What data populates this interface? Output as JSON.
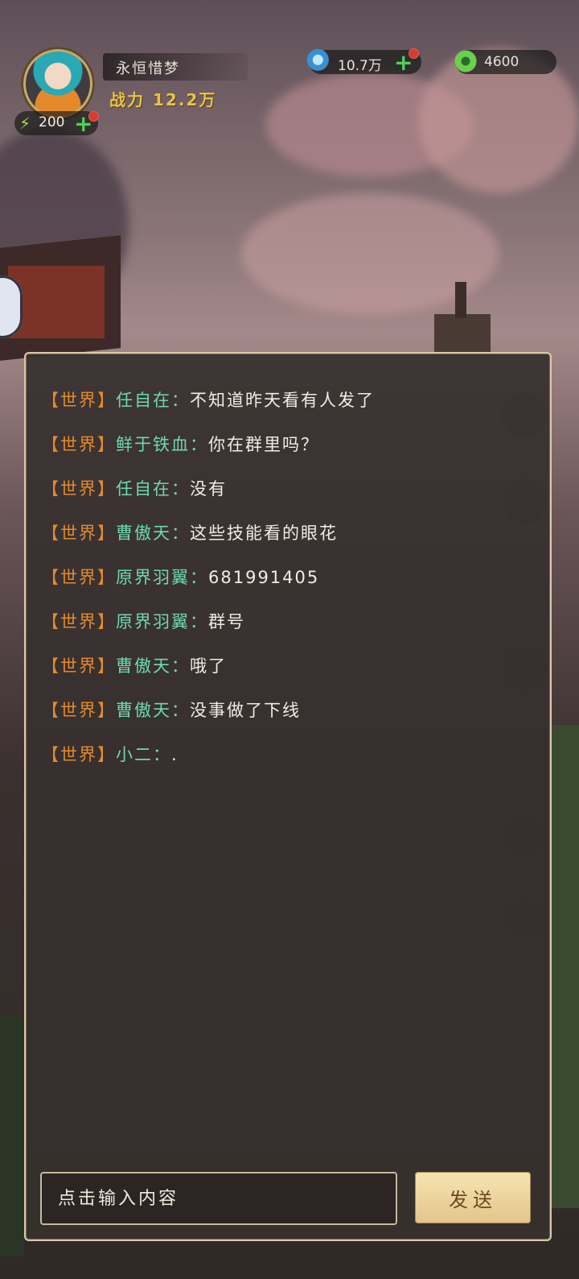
{
  "player": {
    "name": "永恒惜梦",
    "power_label": "战力",
    "power_value": "12.2万",
    "energy": "200"
  },
  "resources": [
    {
      "icon": "jade-gem-icon",
      "value": "10.7万"
    },
    {
      "icon": "green-coin-icon",
      "value": "4600"
    }
  ],
  "chat": {
    "messages": [
      {
        "channel": "【世界】",
        "sender": "任自在：",
        "text": "不知道昨天看有人发了"
      },
      {
        "channel": "【世界】",
        "sender": "鲜于铁血：",
        "text": "你在群里吗？"
      },
      {
        "channel": "【世界】",
        "sender": "任自在：",
        "text": "没有"
      },
      {
        "channel": "【世界】",
        "sender": "曹傲天：",
        "text": "这些技能看的眼花"
      },
      {
        "channel": "【世界】",
        "sender": "原界羽翼：",
        "text": "681991405"
      },
      {
        "channel": "【世界】",
        "sender": "原界羽翼：",
        "text": "群号"
      },
      {
        "channel": "【世界】",
        "sender": "曹傲天：",
        "text": "哦了"
      },
      {
        "channel": "【世界】",
        "sender": "曹傲天：",
        "text": "没事做了下线"
      },
      {
        "channel": "【世界】",
        "sender": "小二：",
        "text": "."
      }
    ],
    "input_placeholder": "点击输入内容",
    "send_label": "发送"
  },
  "colors": {
    "channel": "#e38a2e",
    "sender": "#6fd6b6",
    "text": "#f1ece4"
  }
}
